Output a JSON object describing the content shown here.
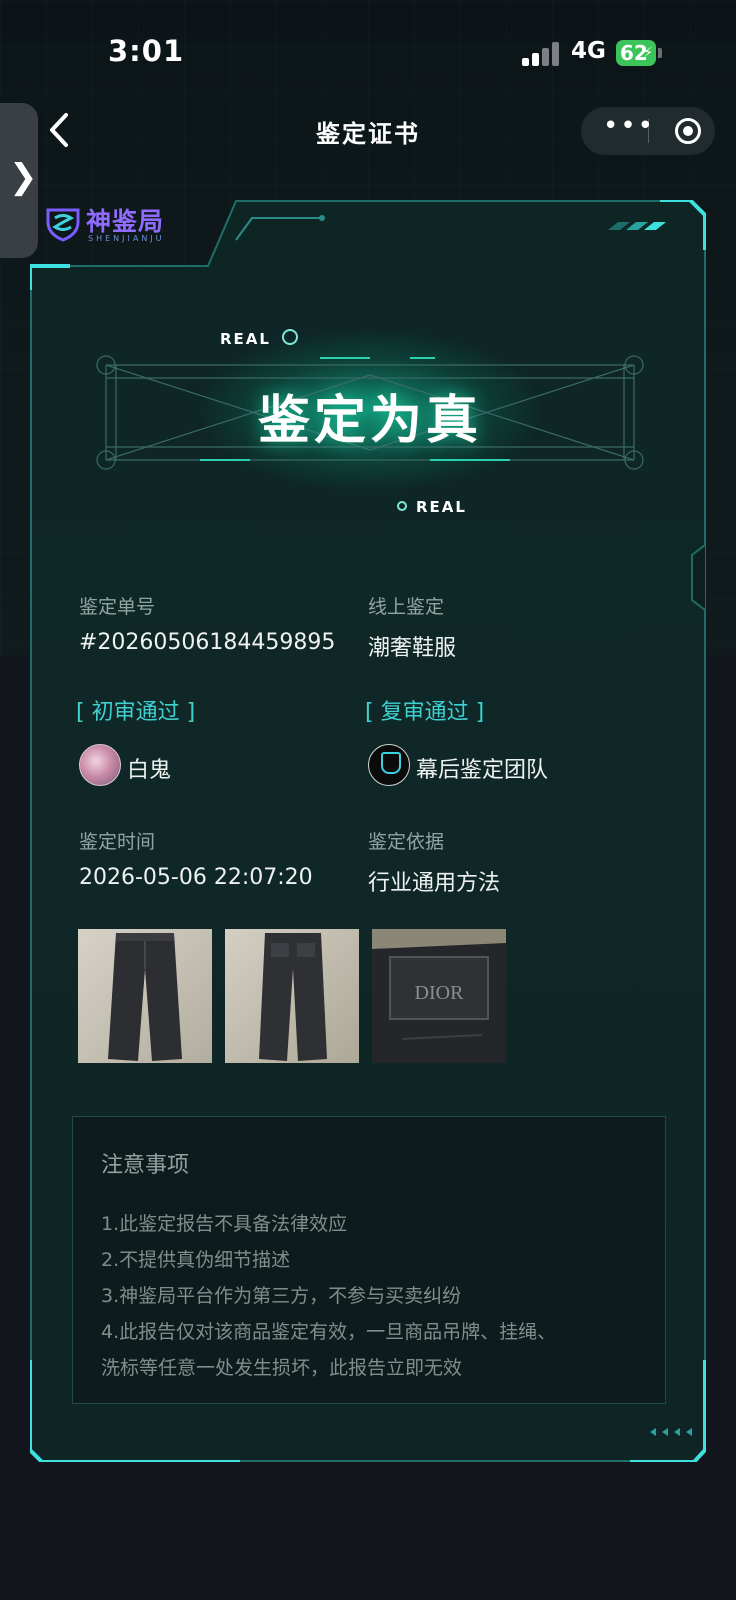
{
  "status_bar": {
    "time": "3:01",
    "network": "4G",
    "battery": "62"
  },
  "nav": {
    "title": "鉴定证书"
  },
  "logo": {
    "name": "神鉴局",
    "subtitle": "SHENJIANJU"
  },
  "hero": {
    "title": "鉴定为真",
    "badge_top": "REAL",
    "badge_bottom": "REAL"
  },
  "info": {
    "order_label": "鉴定单号",
    "order_value": "#20260506184459895",
    "category_label": "线上鉴定",
    "category_value": "潮奢鞋服",
    "first_review_label": "初审通过",
    "first_reviewer": "白鬼",
    "second_review_label": "复审通过",
    "second_reviewer": "幕后鉴定团队",
    "time_label": "鉴定时间",
    "time_value": "2026-05-06 22:07:20",
    "basis_label": "鉴定依据",
    "basis_value": "行业通用方法"
  },
  "photos": {
    "label_text": "DIOR"
  },
  "notes": {
    "title": "注意事项",
    "items": [
      "1.此鉴定报告不具备法律效应",
      "2.不提供真伪细节描述",
      "3.神鉴局平台作为第三方，不参与买卖纠纷",
      "4.此报告仅对该商品鉴定有效，一旦商品吊牌、挂绳、",
      "洗标等任意一处发生损坏，此报告立即无效"
    ]
  },
  "colors": {
    "accent": "#3fd0cf",
    "card_bg": "#0f2827",
    "page_bg": "#12151c"
  }
}
